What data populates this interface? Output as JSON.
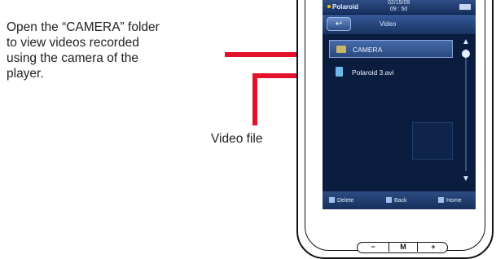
{
  "callouts": {
    "camera_folder_note": "Open the “CAMERA” folder\nto view videos recorded\nusing the camera of the\nplayer.",
    "video_file_note": "Video file"
  },
  "device": {
    "status_bar": {
      "brand": "Polaroid",
      "datetime": "02/15/09\n09 : 50"
    },
    "title_bar": {
      "title": "Video",
      "back_label": "↩"
    },
    "list": [
      {
        "label": "CAMERA",
        "type": "folder",
        "selected": true
      },
      {
        "label": "Polaroid 3.avi",
        "type": "video-file",
        "selected": false
      }
    ],
    "bottom_bar": {
      "delete": "Delete",
      "back": "Back",
      "home": "Home"
    },
    "hardware_buttons": {
      "minus": "−",
      "m": "M",
      "plus": "+"
    }
  },
  "colors": {
    "screen_bg": "#0a1d3f",
    "accent_red": "#e3122b"
  }
}
